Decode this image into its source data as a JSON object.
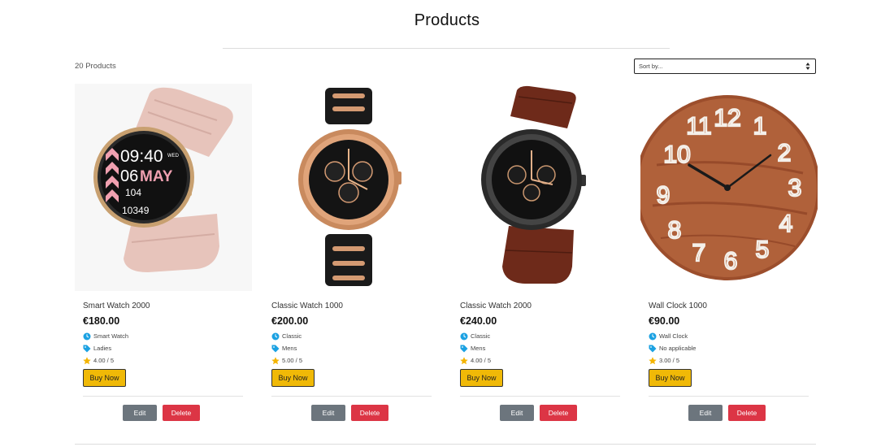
{
  "page": {
    "title": "Products"
  },
  "toolbar": {
    "count_label": "20 Products",
    "sort_placeholder": "Sort by..."
  },
  "colors": {
    "buy_button": "#f0b907",
    "edit_button": "#6c757d",
    "delete_button": "#dc3545",
    "icon_accent": "#1ba1e2",
    "star": "#f4b400"
  },
  "products": [
    {
      "name": "Smart Watch 2000",
      "price": "€180.00",
      "category": "Smart Watch",
      "audience": "Ladies",
      "rating": "4.00 / 5",
      "buy_label": "Buy Now",
      "edit_label": "Edit",
      "delete_label": "Delete",
      "image_icon": "pink-smartwatch-image"
    },
    {
      "name": "Classic Watch 1000",
      "price": "€200.00",
      "category": "Classic",
      "audience": "Mens",
      "rating": "5.00 / 5",
      "buy_label": "Buy Now",
      "edit_label": "Edit",
      "delete_label": "Delete",
      "image_icon": "gold-chronograph-watch-image"
    },
    {
      "name": "Classic Watch 2000",
      "price": "€240.00",
      "category": "Classic",
      "audience": "Mens",
      "rating": "4.00 / 5",
      "buy_label": "Buy Now",
      "edit_label": "Edit",
      "delete_label": "Delete",
      "image_icon": "leather-strap-watch-image"
    },
    {
      "name": "Wall Clock 1000",
      "price": "€90.00",
      "category": "Wall Clock",
      "audience": "No applicable",
      "rating": "3.00 / 5",
      "buy_label": "Buy Now",
      "edit_label": "Edit",
      "delete_label": "Delete",
      "image_icon": "wooden-wall-clock-image"
    }
  ],
  "images": {
    "smartwatch": {
      "time": "09:40",
      "day": "WED",
      "date": "06",
      "month": "MAY",
      "heart_rate": "104",
      "steps": "10349"
    },
    "wall_clock": {
      "numbers": [
        "12",
        "1",
        "2",
        "3",
        "4",
        "5",
        "6",
        "7",
        "8",
        "9",
        "10",
        "11"
      ]
    }
  }
}
